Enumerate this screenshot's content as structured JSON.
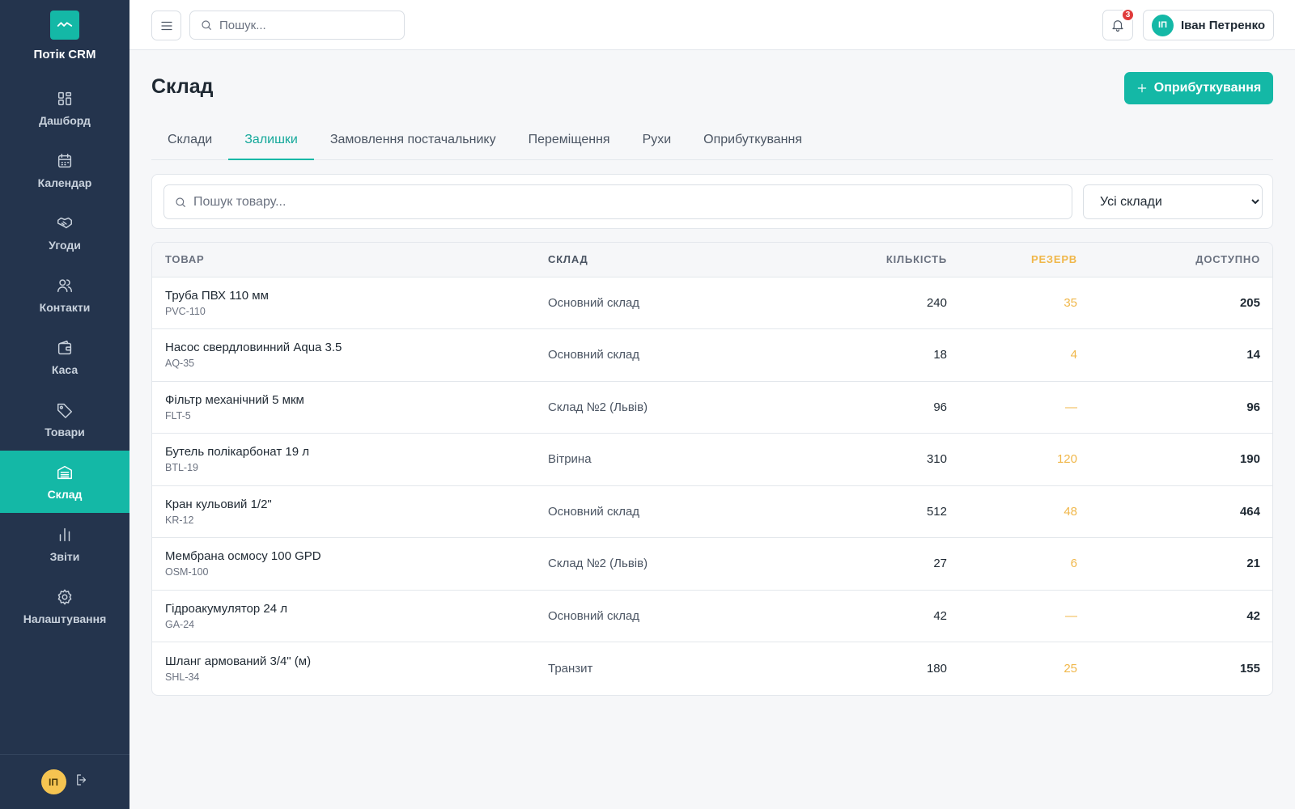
{
  "brand": {
    "name": "Потік CRM"
  },
  "nav": [
    {
      "label": "Дашборд",
      "icon": "grid-icon",
      "active": false
    },
    {
      "label": "Календар",
      "icon": "calendar-icon",
      "active": false
    },
    {
      "label": "Угоди",
      "icon": "handshake-icon",
      "active": false
    },
    {
      "label": "Контакти",
      "icon": "users-icon",
      "active": false
    },
    {
      "label": "Каса",
      "icon": "wallet-icon",
      "active": false
    },
    {
      "label": "Товари",
      "icon": "tag-icon",
      "active": false
    },
    {
      "label": "Склад",
      "icon": "warehouse-icon",
      "active": true
    },
    {
      "label": "Звіти",
      "icon": "bar-chart-icon",
      "active": false
    },
    {
      "label": "Налаштування",
      "icon": "gear-icon",
      "active": false
    }
  ],
  "sidebar_footer": {
    "avatar_initials": "ІП"
  },
  "topbar": {
    "search_placeholder": "Пошук...",
    "notifications_count": "3",
    "user_initials": "ІП",
    "user_name": "Іван Петренко"
  },
  "page": {
    "title": "Склад",
    "primary_button": "Оприбуткування"
  },
  "tabs": [
    {
      "label": "Склади",
      "active": false
    },
    {
      "label": "Залишки",
      "active": true
    },
    {
      "label": "Замовлення постачальнику",
      "active": false
    },
    {
      "label": "Переміщення",
      "active": false
    },
    {
      "label": "Рухи",
      "active": false
    },
    {
      "label": "Оприбуткування",
      "active": false
    }
  ],
  "filters": {
    "search_placeholder": "Пошук товару...",
    "warehouse_selected": "Усі склади"
  },
  "table": {
    "columns": {
      "product": "ТОВАР",
      "warehouse": "СКЛАД",
      "quantity": "КІЛЬКІСТЬ",
      "reserve": "РЕЗЕРВ",
      "available": "ДОСТУПНО"
    },
    "rows": [
      {
        "name": "Труба ПВХ 110 мм",
        "sku": "PVC-110",
        "warehouse": "Основний склад",
        "quantity": "240",
        "reserve": "35",
        "available": "205"
      },
      {
        "name": "Насос свердловинний Aqua 3.5",
        "sku": "AQ-35",
        "warehouse": "Основний склад",
        "quantity": "18",
        "reserve": "4",
        "available": "14"
      },
      {
        "name": "Фільтр механічний 5 мкм",
        "sku": "FLT-5",
        "warehouse": "Склад №2 (Львів)",
        "quantity": "96",
        "reserve": "—",
        "available": "96"
      },
      {
        "name": "Бутель полікарбонат 19 л",
        "sku": "BTL-19",
        "warehouse": "Вітрина",
        "quantity": "310",
        "reserve": "120",
        "available": "190"
      },
      {
        "name": "Кран кульовий 1/2\"",
        "sku": "KR-12",
        "warehouse": "Основний склад",
        "quantity": "512",
        "reserve": "48",
        "available": "464"
      },
      {
        "name": "Мембрана осмосу 100 GPD",
        "sku": "OSM-100",
        "warehouse": "Склад №2 (Львів)",
        "quantity": "27",
        "reserve": "6",
        "available": "21"
      },
      {
        "name": "Гідроакумулятор 24 л",
        "sku": "GA-24",
        "warehouse": "Основний склад",
        "quantity": "42",
        "reserve": "—",
        "available": "42"
      },
      {
        "name": "Шланг армований 3/4\" (м)",
        "sku": "SHL-34",
        "warehouse": "Транзит",
        "quantity": "180",
        "reserve": "25",
        "available": "155"
      }
    ]
  },
  "colors": {
    "sidebar": "#24344d",
    "accent": "#14b8a6",
    "reserve": "#f0b74a",
    "badge": "#e03b3b"
  }
}
